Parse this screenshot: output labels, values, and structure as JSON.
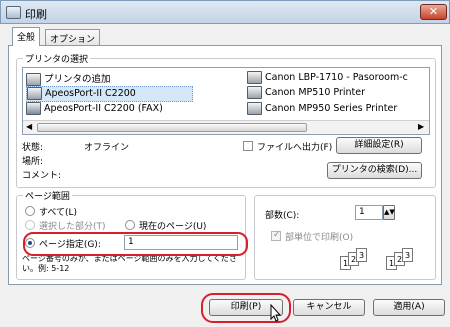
{
  "window": {
    "title": "印刷",
    "close_glyph": "✕"
  },
  "tabs": [
    {
      "label": "全般",
      "active": true
    },
    {
      "label": "オプション",
      "active": false
    }
  ],
  "printer_select": {
    "group_label": "プリンタの選択",
    "printers_col1": [
      {
        "label": "プリンタの追加",
        "icon": "add-printer-icon"
      },
      {
        "label": "ApeosPort-II C2200",
        "icon": "printer-icon",
        "selected": true
      },
      {
        "label": "ApeosPort-II C2200 (FAX)",
        "icon": "fax-icon"
      }
    ],
    "printers_col2": [
      {
        "label": "Canon LBP-1710 - Pasoroom-c",
        "icon": "printer-icon"
      },
      {
        "label": "Canon MP510 Printer",
        "icon": "printer-icon"
      },
      {
        "label": "Canon MP950 Series Printer",
        "icon": "printer-icon"
      }
    ],
    "status_label": "状態:",
    "status_value": "オフライン",
    "location_label": "場所:",
    "comment_label": "コメント:",
    "print_to_file_label": "ファイルへ出力(F)",
    "print_to_file_checked": false,
    "preferences_button": "詳細設定(R)",
    "find_printer_button": "プリンタの検索(D)..."
  },
  "page_range": {
    "group_label": "ページ範囲",
    "all_label": "すべて(L)",
    "selection_label": "選択した部分(T)",
    "current_page_label": "現在のページ(U)",
    "pages_label": "ページ指定(G):",
    "pages_value": "1",
    "selected_option": "pages",
    "hint": "ページ番号のみか、またはページ範囲のみを入力してください。例: 5-12"
  },
  "copies": {
    "copies_label": "部数(C):",
    "copies_value": "1",
    "collate_label": "部単位で印刷(O)",
    "collate_checked": true,
    "collate_set1": [
      "1",
      "2",
      "3"
    ],
    "collate_set2": [
      "1",
      "2",
      "3"
    ]
  },
  "footer": {
    "print_button": "印刷(P)",
    "cancel_button": "キャンセル",
    "apply_button": "適用(A)"
  },
  "colors": {
    "highlight_ring": "#d81f2a",
    "selection_bg": "#d6e7f8"
  }
}
